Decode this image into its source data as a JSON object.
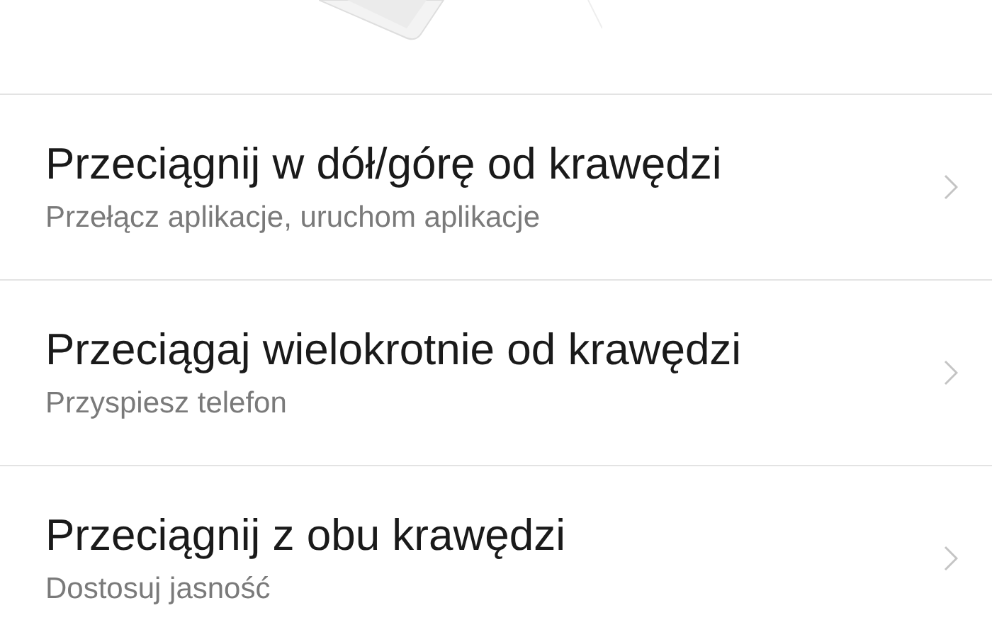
{
  "items": [
    {
      "title": "Przeciągnij w dół/górę od krawędzi",
      "subtitle": "Przełącz aplikacje, uruchom aplikacje"
    },
    {
      "title": "Przeciągaj wielokrotnie od krawędzi",
      "subtitle": "Przyspiesz telefon"
    },
    {
      "title": "Przeciągnij z obu krawędzi",
      "subtitle": "Dostosuj jasność"
    }
  ]
}
